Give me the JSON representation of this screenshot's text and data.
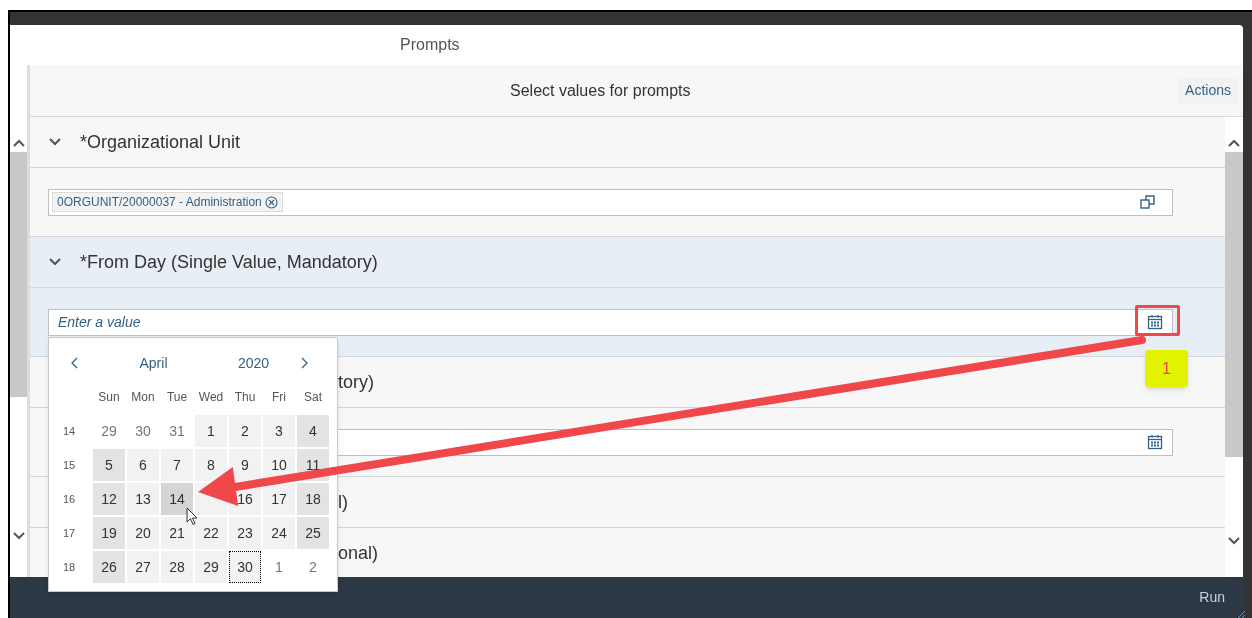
{
  "dialog": {
    "title": "Prompts",
    "subtitle": "Select values for prompts",
    "actions_button": "Actions",
    "run_button": "Run"
  },
  "prompts": [
    {
      "label": "*Organizational Unit",
      "selected": false,
      "field": {
        "kind": "tokens",
        "tokens": [
          "0ORGUNIT/20000037 - Administration"
        ]
      }
    },
    {
      "label": "*From Day (Single Value, Mandatory)",
      "selected": true,
      "field": {
        "kind": "date",
        "placeholder": "Enter a value",
        "highlighted": true
      }
    },
    {
      "label": "tory)",
      "selected": false,
      "field": {
        "kind": "date",
        "highlighted": false
      }
    },
    {
      "label": "l)",
      "selected": false
    },
    {
      "label": "onal)",
      "selected": false
    }
  ],
  "calendar": {
    "month": "April",
    "year": "2020",
    "weekdays": [
      "Sun",
      "Mon",
      "Tue",
      "Wed",
      "Thu",
      "Fri",
      "Sat"
    ],
    "weeks": [
      {
        "number": "14",
        "days": [
          {
            "day": "29",
            "kind": "other",
            "hovered": false,
            "focused": false
          },
          {
            "day": "30",
            "kind": "other",
            "hovered": false,
            "focused": false
          },
          {
            "day": "31",
            "kind": "other",
            "hovered": false,
            "focused": false
          },
          {
            "day": "1",
            "kind": "weekday",
            "hovered": false,
            "focused": false
          },
          {
            "day": "2",
            "kind": "weekday",
            "hovered": false,
            "focused": false
          },
          {
            "day": "3",
            "kind": "weekday",
            "hovered": false,
            "focused": false
          },
          {
            "day": "4",
            "kind": "weekend",
            "hovered": false,
            "focused": false
          }
        ]
      },
      {
        "number": "15",
        "days": [
          {
            "day": "5",
            "kind": "weekend",
            "hovered": false,
            "focused": false
          },
          {
            "day": "6",
            "kind": "weekday",
            "hovered": false,
            "focused": false
          },
          {
            "day": "7",
            "kind": "weekday",
            "hovered": false,
            "focused": false
          },
          {
            "day": "8",
            "kind": "weekday",
            "hovered": false,
            "focused": false
          },
          {
            "day": "9",
            "kind": "weekday",
            "hovered": false,
            "focused": false
          },
          {
            "day": "10",
            "kind": "weekday",
            "hovered": false,
            "focused": false
          },
          {
            "day": "11",
            "kind": "weekend",
            "hovered": false,
            "focused": false
          }
        ]
      },
      {
        "number": "16",
        "days": [
          {
            "day": "12",
            "kind": "weekend",
            "hovered": false,
            "focused": false
          },
          {
            "day": "13",
            "kind": "weekday",
            "hovered": false,
            "focused": false
          },
          {
            "day": "14",
            "kind": "weekday",
            "hovered": true,
            "focused": false
          },
          {
            "kind": "weekday",
            "hovered": false,
            "focused": false
          },
          {
            "day": "16",
            "kind": "weekday",
            "hovered": false,
            "focused": false
          },
          {
            "day": "17",
            "kind": "weekday",
            "hovered": false,
            "focused": false
          },
          {
            "day": "18",
            "kind": "weekend",
            "hovered": false,
            "focused": false
          }
        ]
      },
      {
        "number": "17",
        "days": [
          {
            "day": "19",
            "kind": "weekend",
            "hovered": false,
            "focused": false
          },
          {
            "day": "20",
            "kind": "weekday",
            "hovered": false,
            "focused": false
          },
          {
            "day": "21",
            "kind": "weekday",
            "hovered": false,
            "focused": false
          },
          {
            "day": "22",
            "kind": "weekday",
            "hovered": false,
            "focused": false
          },
          {
            "day": "23",
            "kind": "weekday",
            "hovered": false,
            "focused": false
          },
          {
            "day": "24",
            "kind": "weekday",
            "hovered": false,
            "focused": false
          },
          {
            "day": "25",
            "kind": "weekend",
            "hovered": false,
            "focused": false
          }
        ]
      },
      {
        "number": "18",
        "days": [
          {
            "day": "26",
            "kind": "weekend",
            "hovered": false,
            "focused": false
          },
          {
            "day": "27",
            "kind": "weekday",
            "hovered": false,
            "focused": false
          },
          {
            "day": "28",
            "kind": "weekday",
            "hovered": false,
            "focused": false
          },
          {
            "day": "29",
            "kind": "weekday",
            "hovered": false,
            "focused": false
          },
          {
            "day": "30",
            "kind": "weekday",
            "hovered": false,
            "focused": true
          },
          {
            "day": "1",
            "kind": "other",
            "hovered": false,
            "focused": false
          },
          {
            "day": "2",
            "kind": "other",
            "hovered": false,
            "focused": false
          }
        ]
      }
    ]
  },
  "annotation": {
    "badge": "1"
  }
}
